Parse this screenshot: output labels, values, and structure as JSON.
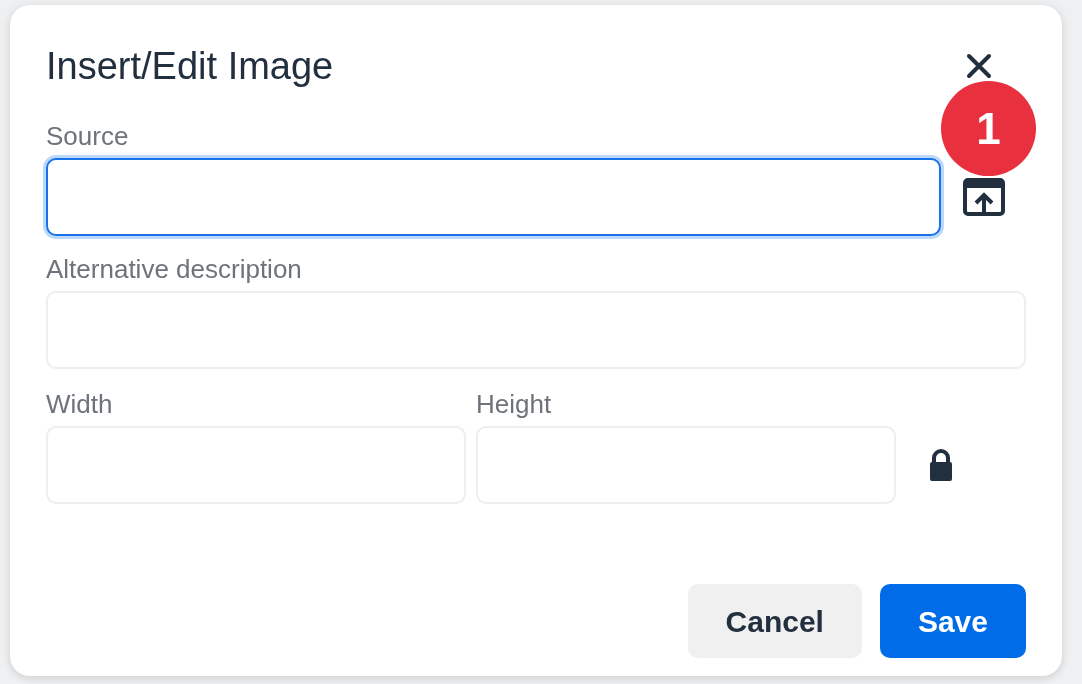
{
  "dialog": {
    "title": "Insert/Edit Image"
  },
  "step_badge": {
    "label": "1"
  },
  "fields": [
    {
      "label": "Source",
      "focused": true,
      "kind": "upload"
    },
    {
      "label": "Alternative description",
      "focused": false,
      "kind": "full"
    }
  ],
  "size_fields": [
    {
      "label": "Width",
      "focused": false
    },
    {
      "label": "Height",
      "focused": false
    }
  ],
  "constrain_proportions": {
    "locked": true
  },
  "buttons": [
    {
      "label": "Cancel",
      "kind": "secondary"
    },
    {
      "label": "Save",
      "kind": "primary"
    }
  ]
}
